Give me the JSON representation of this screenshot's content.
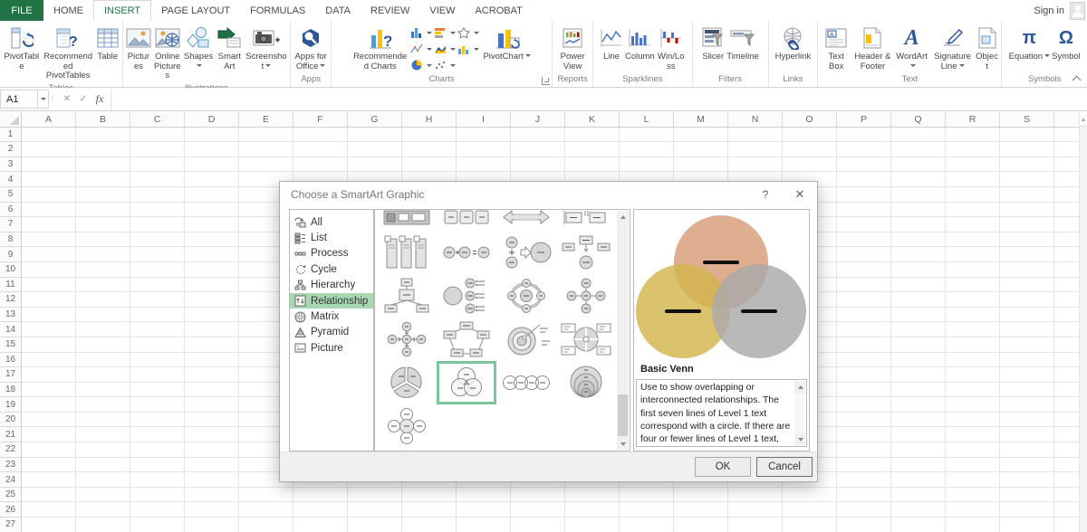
{
  "tabs": {
    "file": "FILE",
    "home": "HOME",
    "insert": "INSERT",
    "page_layout": "PAGE LAYOUT",
    "formulas": "FORMULAS",
    "data": "DATA",
    "review": "REVIEW",
    "view": "VIEW",
    "acrobat": "ACROBAT",
    "active_tab": "INSERT",
    "sign_in": "Sign in"
  },
  "ribbon": {
    "tables": {
      "label": "Tables",
      "pivottable": "PivotTable",
      "recommended_pivottables": "Recommended PivotTables",
      "table": "Table"
    },
    "illustrations": {
      "label": "Illustrations",
      "pictures": "Pictures",
      "online_pictures": "Online Pictures",
      "shapes": "Shapes",
      "smartart": "SmartArt",
      "screenshot": "Screenshot"
    },
    "apps": {
      "label": "Apps",
      "apps_for_office": "Apps for Office"
    },
    "charts": {
      "label": "Charts",
      "recommended_charts": "Recommended Charts",
      "pivotchart": "PivotChart"
    },
    "reports": {
      "label": "Reports",
      "power_view": "Power View"
    },
    "sparklines": {
      "label": "Sparklines",
      "line": "Line",
      "column": "Column",
      "win_loss": "Win/Loss"
    },
    "filters": {
      "label": "Filters",
      "slicer": "Slicer",
      "timeline": "Timeline"
    },
    "links": {
      "label": "Links",
      "hyperlink": "Hyperlink"
    },
    "text": {
      "label": "Text",
      "text_box": "Text Box",
      "header_footer": "Header & Footer",
      "wordart": "WordArt",
      "signature_line": "Signature Line",
      "object": "Object"
    },
    "symbols": {
      "label": "Symbols",
      "equation": "Equation",
      "symbol": "Symbol"
    }
  },
  "icons": {
    "equation_glyph": "π",
    "symbol_glyph": "Ω",
    "wordart_glyph": "A",
    "cancel_glyph": "✕",
    "enter_glyph": "✓",
    "fx_glyph": "fx",
    "help_glyph": "?",
    "close_glyph": "✕",
    "dots_glyph": "⋮"
  },
  "formula_bar": {
    "name_box": "A1"
  },
  "grid": {
    "columns": [
      "A",
      "B",
      "C",
      "D",
      "E",
      "F",
      "G",
      "H",
      "I",
      "J",
      "K",
      "L",
      "M",
      "N",
      "O",
      "P",
      "Q",
      "R",
      "S",
      ""
    ],
    "row_count": 27
  },
  "dialog": {
    "title": "Choose a SmartArt Graphic",
    "categories": [
      "All",
      "List",
      "Process",
      "Cycle",
      "Hierarchy",
      "Relationship",
      "Matrix",
      "Pyramid",
      "Picture"
    ],
    "selected_category": "Relationship",
    "preview": {
      "title": "Basic Venn",
      "description": "Use to show overlapping or interconnected relationships. The first seven lines of Level 1 text correspond with a circle. If there are four or fewer lines of Level 1 text, the text is inside the circles. If there are more than four lines of Level 1 text, the text is outside",
      "venn_colors": {
        "top": "#d89b76",
        "left": "#d3b44c",
        "right": "#a9a9ab"
      }
    },
    "ok": "OK",
    "cancel": "Cancel"
  },
  "colors": {
    "accent_green": "#217346",
    "category_selected": "#a7d8b1",
    "thumb_selected_border": "#7cc598"
  }
}
